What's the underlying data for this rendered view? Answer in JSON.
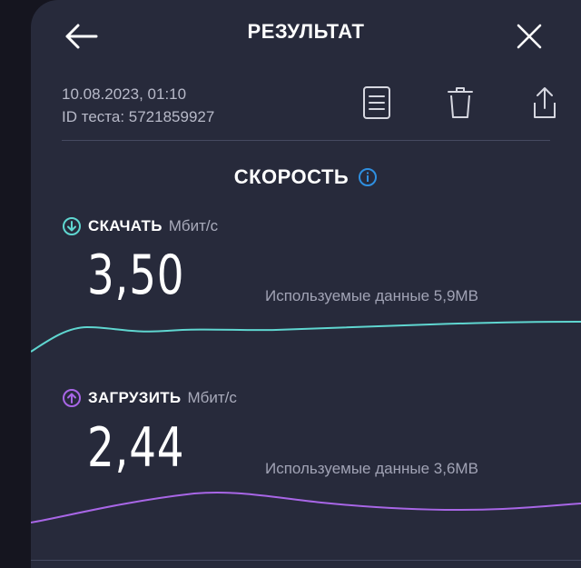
{
  "header": {
    "title": "РЕЗУЛЬТАТ",
    "back_icon": "arrow-left-icon",
    "close_icon": "close-icon"
  },
  "test_info": {
    "datetime": "10.08.2023, 01:10",
    "test_id": "ID теста: 5721859927",
    "actions": [
      "document-icon",
      "trash-icon",
      "share-icon"
    ]
  },
  "speed": {
    "section_title": "СКОРОСТЬ",
    "info_icon": "info-icon",
    "download": {
      "label": "СКАЧАТЬ",
      "unit": "Мбит/с",
      "value": "3,50",
      "data_used": "Используемые данные 5,9MB",
      "color": "#5fd6d0"
    },
    "upload": {
      "label": "ЗАГРУЗИТЬ",
      "unit": "Мбит/с",
      "value": "2,44",
      "data_used": "Используемые данные 3,6MB",
      "color": "#a866e6"
    }
  },
  "colors": {
    "background": "#15151f",
    "panel": "#272a3b",
    "info_accent": "#2f8fe0"
  }
}
